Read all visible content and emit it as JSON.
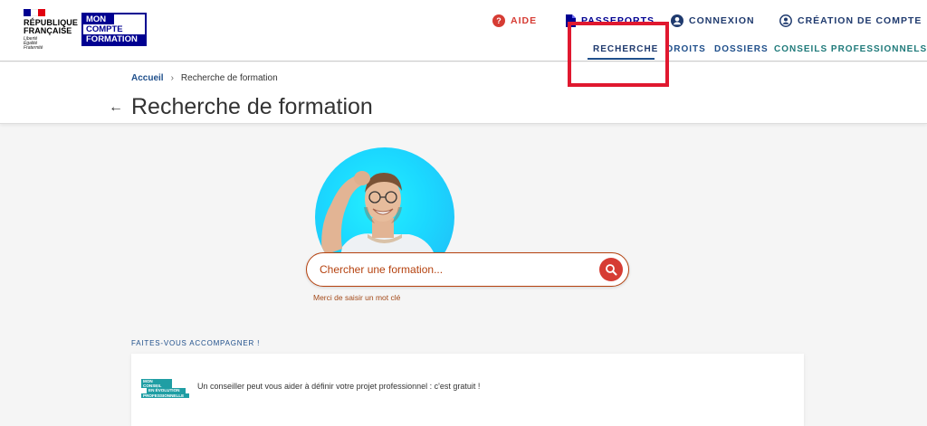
{
  "header": {
    "republique_line1": "RÉPUBLIQUE",
    "republique_line2": "FRANÇAISE",
    "motto_line1": "Liberté",
    "motto_line2": "Égalité",
    "motto_line3": "Fraternité",
    "brand_line1": "MON",
    "brand_line2": "COMPTE",
    "brand_line3": "FORMATION",
    "top_links": {
      "aide": "AIDE",
      "passeports": "PASSEPORTS",
      "connexion": "CONNEXION",
      "creation": "CRÉATION DE COMPTE"
    },
    "nav": {
      "recherche": "RECHERCHE",
      "droits": "DROITS",
      "dossiers": "DOSSIERS",
      "conseils": "CONSEILS PROFESSIONNELS"
    },
    "active_nav": "RECHERCHE"
  },
  "breadcrumb": {
    "home": "Accueil",
    "separator": "›",
    "current": "Recherche de formation"
  },
  "page": {
    "title": "Recherche de formation"
  },
  "search": {
    "placeholder": "Chercher une formation...",
    "value": "",
    "help_text": "Merci de saisir un mot clé"
  },
  "accompagner": {
    "section_label": "FAITES-VOUS ACCOMPAGNER !",
    "logo_line1": "MON CONSEIL",
    "logo_line2": "EN ÉVOLUTION",
    "logo_line3": "PROFESSIONNELLE",
    "text": "Un conseiller peut vous aider à définir votre projet professionnel : c'est gratuit !"
  },
  "colors": {
    "primary_blue": "#1f4f8b",
    "search_accent": "#b5420f",
    "search_button": "#d63c34",
    "highlight_box": "#e0182f"
  },
  "icons": {
    "aide": "question-circle-icon",
    "passeports": "document-icon",
    "connexion": "user-circle-icon",
    "creation": "user-circle-icon",
    "search": "search-icon",
    "back": "back-arrow-icon"
  }
}
